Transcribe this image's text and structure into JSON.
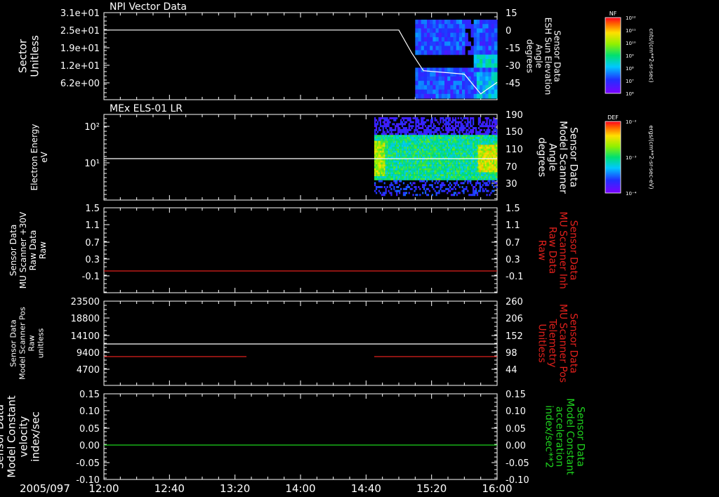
{
  "colors": {
    "white": "#ffffff",
    "red": "#e0201c",
    "green": "#1ed21e",
    "background": "#000000"
  },
  "footer": {
    "date": "2005/097",
    "x_ticks": [
      "12:00",
      "12:40",
      "13:20",
      "14:00",
      "14:40",
      "15:20",
      "16:00"
    ]
  },
  "chart_data": [
    {
      "type": "heatmap",
      "title": "NPI Vector Data",
      "ylabel": [
        "Sector",
        "Unitless"
      ],
      "y_ticks": [
        "3.1e+01",
        "2.5e+01",
        "1.9e+01",
        "1.2e+01",
        "6.2e+00"
      ],
      "right_label": [
        "Sensor Data",
        "ESH Sun Elevation",
        "Angle",
        "degrees"
      ],
      "right_ticks": [
        "15",
        "0",
        "-15",
        "-30",
        "-45"
      ],
      "right_ylim": [
        15,
        -60
      ],
      "colorbar": {
        "label": "NF",
        "units": "cnts/(cm**2-sr-sec)",
        "ticks": [
          "10¹²",
          "10¹¹",
          "10¹⁰",
          "10⁹",
          "10⁸",
          "10⁷",
          "10⁶"
        ]
      },
      "data_start": "15:10",
      "line": {
        "name": "ESH Sun Elevation Angle",
        "x": [
          "12:00",
          "15:00",
          "15:08",
          "15:15",
          "15:40",
          "15:50",
          "16:00"
        ],
        "y": [
          0,
          0,
          -20,
          -35,
          -38,
          -55,
          -45
        ]
      }
    },
    {
      "type": "heatmap",
      "title": "MEx ELS-01 LR",
      "ylabel": [
        "Electron Energy",
        "eV"
      ],
      "y_ticks": [
        "10²",
        "10¹"
      ],
      "ylim": [
        1,
        200
      ],
      "right_label": [
        "Sensor Data",
        "Model Scanner",
        "Angle",
        "degrees"
      ],
      "right_ticks": [
        "190",
        "150",
        "110",
        "70",
        "30"
      ],
      "right_ylim": [
        0,
        190
      ],
      "colorbar": {
        "label": "DEF",
        "units": "ergs/(cm**2-sr-sec-eV)",
        "ticks": [
          "10⁻²",
          "10⁻³",
          "10⁻⁴"
        ]
      },
      "data_start": "14:45",
      "line": {
        "name": "Model Scanner Angle",
        "x": [
          "12:00",
          "16:00"
        ],
        "y": [
          90,
          90
        ]
      }
    },
    {
      "type": "line",
      "ylabel": [
        "Sensor Data",
        "MU Scanner +30V",
        "Raw Data",
        "Raw"
      ],
      "y_ticks": [
        "1.5",
        "1.1",
        "0.7",
        "0.3",
        "-0.1"
      ],
      "ylim": [
        -0.3,
        1.5
      ],
      "right_label": [
        "Sensor Data",
        "MU Scanner Inh",
        "Raw Data",
        "Raw"
      ],
      "right_ticks": [
        "1.5",
        "1.1",
        "0.7",
        "0.3",
        "-0.1"
      ],
      "series": [
        {
          "name": "MU Scanner Inh Raw Data",
          "color": "red",
          "x": [
            "12:00",
            "16:00"
          ],
          "y": [
            0,
            0
          ]
        }
      ]
    },
    {
      "type": "line",
      "ylabel": [
        "Sensor Data",
        "Model Scanner Pos",
        "Raw",
        "unitless"
      ],
      "y_ticks": [
        "23500",
        "18800",
        "14100",
        "9400",
        "4700"
      ],
      "ylim": [
        0,
        23500
      ],
      "right_label": [
        "Sensor Data",
        "MU Scanner Pos",
        "Telemetry",
        "Unitless"
      ],
      "right_ticks": [
        "260",
        "206",
        "152",
        "98",
        "44"
      ],
      "right_ylim": [
        -10,
        260
      ],
      "series": [
        {
          "name": "Model Scanner Pos Raw",
          "color": "white",
          "x": [
            "12:00",
            "16:00"
          ],
          "y": [
            11700,
            11700
          ]
        },
        {
          "name": "MU Scanner Pos Telemetry",
          "color": "red",
          "segments": [
            {
              "x": [
                "12:00",
                "13:27"
              ],
              "y": [
                90,
                90
              ]
            },
            {
              "x": [
                "14:45",
                "16:00"
              ],
              "y": [
                90,
                90
              ]
            }
          ]
        }
      ]
    },
    {
      "type": "line",
      "ylabel": [
        "Sensor Data",
        "Model Constant",
        "velocity",
        "index/sec"
      ],
      "y_ticks": [
        "0.15",
        "0.10",
        "0.05",
        "0.00",
        "-0.05",
        "-0.10"
      ],
      "ylim": [
        -0.1,
        0.15
      ],
      "right_label": [
        "Sensor Data",
        "Model Constant",
        "acceleration",
        "index/sec**2"
      ],
      "right_ticks": [
        "0.15",
        "0.10",
        "0.05",
        "0.00",
        "-0.05",
        "-0.10"
      ],
      "series": [
        {
          "name": "Model Constant acceleration",
          "color": "green",
          "x": [
            "12:00",
            "16:00"
          ],
          "y": [
            0,
            0
          ]
        }
      ]
    }
  ]
}
